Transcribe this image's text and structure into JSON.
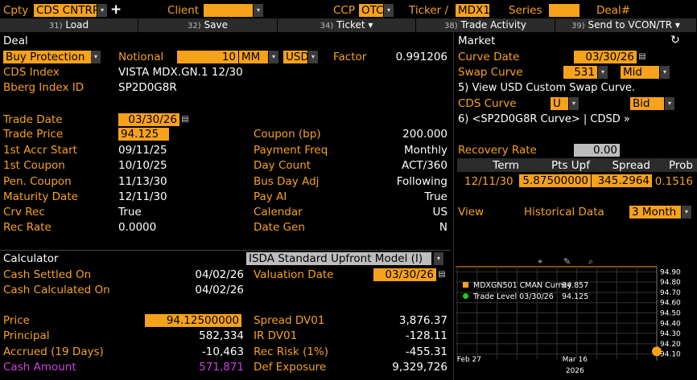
{
  "topbar": {
    "cpty_label": "Cpty",
    "cpty_value": "CDS CNTRP.",
    "plus": "+",
    "client_label": "Client",
    "client_value": "",
    "ccp_label": "CCP",
    "ccp_value": "OTC",
    "ticker_label": "Ticker /",
    "ticker_value": "MDX1",
    "series_label": "Series",
    "series_value": "",
    "deal_label": "Deal#"
  },
  "toolbar": {
    "load": {
      "num": "31)",
      "label": "Load"
    },
    "save": {
      "num": "32)",
      "label": "Save"
    },
    "ticket": {
      "num": "34)",
      "label": "Ticket ▾"
    },
    "trade_activity": {
      "num": "38)",
      "label": "Trade Activity"
    },
    "send": {
      "num": "39)",
      "label": "Send to VCON/TR ▾"
    }
  },
  "deal": {
    "title": "Deal",
    "side": "Buy Protection",
    "notional_label": "Notional",
    "notional_value": "10",
    "notional_unit": "MM",
    "currency": "USD",
    "factor_label": "Factor",
    "factor_value": "0.991206",
    "cds_index_label": "CDS Index",
    "cds_index_value": "VISTA MDX.GN.1 12/30",
    "bberg_label": "Bberg Index ID",
    "bberg_value": "SP2D0G8R",
    "trade_date_label": "Trade Date",
    "trade_date_value": "03/30/26",
    "trade_price_label": "Trade Price",
    "trade_price_value": "94.125",
    "coupon_label": "Coupon (bp)",
    "coupon_value": "200.000",
    "accr_label": "1st Accr Start",
    "accr_value": "09/11/25",
    "payfreq_label": "Payment Freq",
    "payfreq_value": "Monthly",
    "first_coupon_label": "1st Coupon",
    "first_coupon_value": "10/10/25",
    "daycount_label": "Day Count",
    "daycount_value": "ACT/360",
    "pen_label": "Pen. Coupon",
    "pen_value": "11/13/30",
    "busday_label": "Bus Day Adj",
    "busday_value": "Following",
    "maturity_label": "Maturity Date",
    "maturity_value": "12/11/30",
    "payai_label": "Pay AI",
    "payai_value": "True",
    "crvrec_label": "Crv Rec",
    "crvrec_value": "True",
    "calendar_label": "Calendar",
    "calendar_value": "US",
    "recrate_label": "Rec Rate",
    "recrate_value": "0.0000",
    "dategen_label": "Date Gen",
    "dategen_value": "N"
  },
  "calculator": {
    "title": "Calculator",
    "model": "ISDA Standard Upfront Model (I)",
    "cash_settled_label": "Cash Settled On",
    "cash_settled_value": "04/02/26",
    "valuation_label": "Valuation Date",
    "valuation_value": "03/30/26",
    "cash_calc_label": "Cash Calculated On",
    "cash_calc_value": "04/02/26",
    "price_label": "Price",
    "price_value": "94.12500000",
    "spread_dv01_label": "Spread DV01",
    "spread_dv01_value": "3,876.37",
    "principal_label": "Principal",
    "principal_value": "582,334",
    "ir_dv01_label": "IR DV01",
    "ir_dv01_value": "-128.11",
    "accrued_label": "Accrued (19 Days)",
    "accrued_value": "-10,463",
    "recrisk_label": "Rec Risk (1%)",
    "recrisk_value": "-455.31",
    "cash_amount_label": "Cash Amount",
    "cash_amount_value": "571,871",
    "def_exp_label": "Def Exposure",
    "def_exp_value": "9,329,726"
  },
  "market": {
    "title": "Market",
    "curve_date_label": "Curve Date",
    "curve_date_value": "03/30/26",
    "swap_curve_label": "Swap Curve",
    "swap_curve_value": "531",
    "swap_curve_side": "Mid",
    "view_swap_link": "5) View USD Custom Swap Curve.",
    "cds_curve_label": "CDS Curve",
    "cds_curve_value": "U",
    "cds_curve_side": "Bid",
    "curve_link": "6) <SP2D0G8R Curve> | CDSD »",
    "recovery_label": "Recovery Rate",
    "recovery_value": "0.00",
    "table_headers": [
      "Term",
      "Pts Upf",
      "Spread",
      "Prob"
    ],
    "table_row": {
      "term": "12/11/30",
      "pts": "5.87500000",
      "spread": "345.2964",
      "prob": "0.1516"
    },
    "view_label": "View",
    "hist_label": "Historical Data",
    "hist_value": "3 Month"
  },
  "chart_data": {
    "type": "line",
    "y_ticks": [
      "94.90",
      "94.80",
      "94.70",
      "94.60",
      "94.50",
      "94.40",
      "94.30",
      "94.20",
      "94.10"
    ],
    "ylim": [
      94.05,
      94.95
    ],
    "x_ticks": [
      {
        "label": "Feb 27",
        "pos": 0.06
      },
      {
        "label": "Mar 16",
        "pos": 0.59
      }
    ],
    "x_year": "2026",
    "series": [
      {
        "name": "MDXGN501 CMAN Curncy",
        "value": "94.857",
        "color": "#f7a21b"
      },
      {
        "name": "Trade Level 03/30/26",
        "value": "94.125",
        "color": "#22cc22"
      }
    ],
    "points": [
      {
        "x": 1.0,
        "y": 94.125
      }
    ],
    "reference_line": 94.95
  }
}
